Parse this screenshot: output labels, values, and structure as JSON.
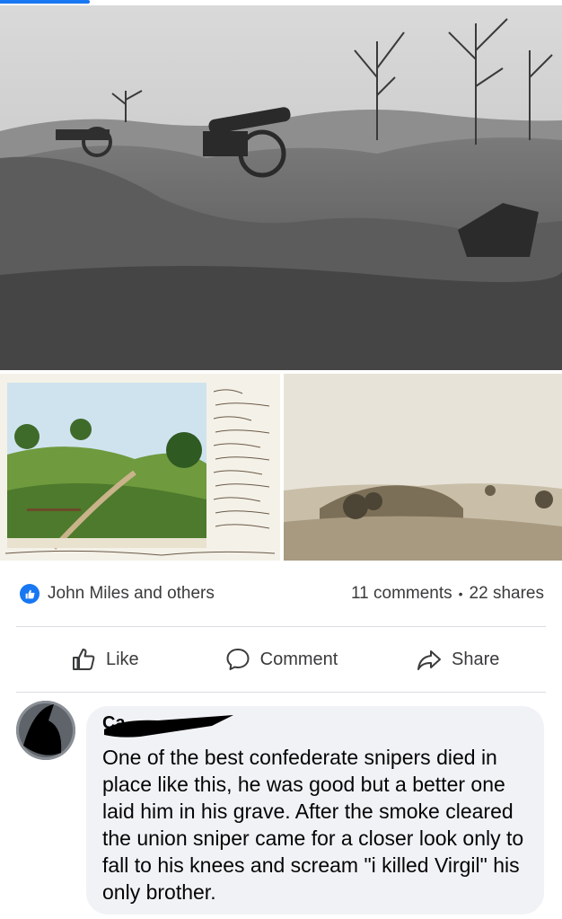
{
  "post": {
    "photos": [
      {
        "alt_icon": "photo-icon"
      },
      {
        "alt_icon": "photo-icon"
      },
      {
        "alt_icon": "photo-icon"
      }
    ],
    "reactions": {
      "icon": "thumbs-up-icon",
      "names": "John Miles and others"
    },
    "comments_count": "11 comments",
    "separator": "•",
    "shares_count": "22 shares",
    "actions": [
      {
        "label": "Like",
        "icon": "like-icon"
      },
      {
        "label": "Comment",
        "icon": "comment-icon"
      },
      {
        "label": "Share",
        "icon": "share-icon"
      }
    ]
  },
  "comment": {
    "author_initial": "Ca",
    "text": "One of the best confederate snipers died in place like this, he was good but a better one laid him in his grave. After the smoke cleared the union sniper came for a closer look only to fall to his knees and scream \"i killed Virgil\" his only brother."
  },
  "colors": {
    "brand": "#1877f2",
    "bubble": "#f0f2f5",
    "text": "#050505",
    "secondary_text": "#3a3b3c"
  }
}
